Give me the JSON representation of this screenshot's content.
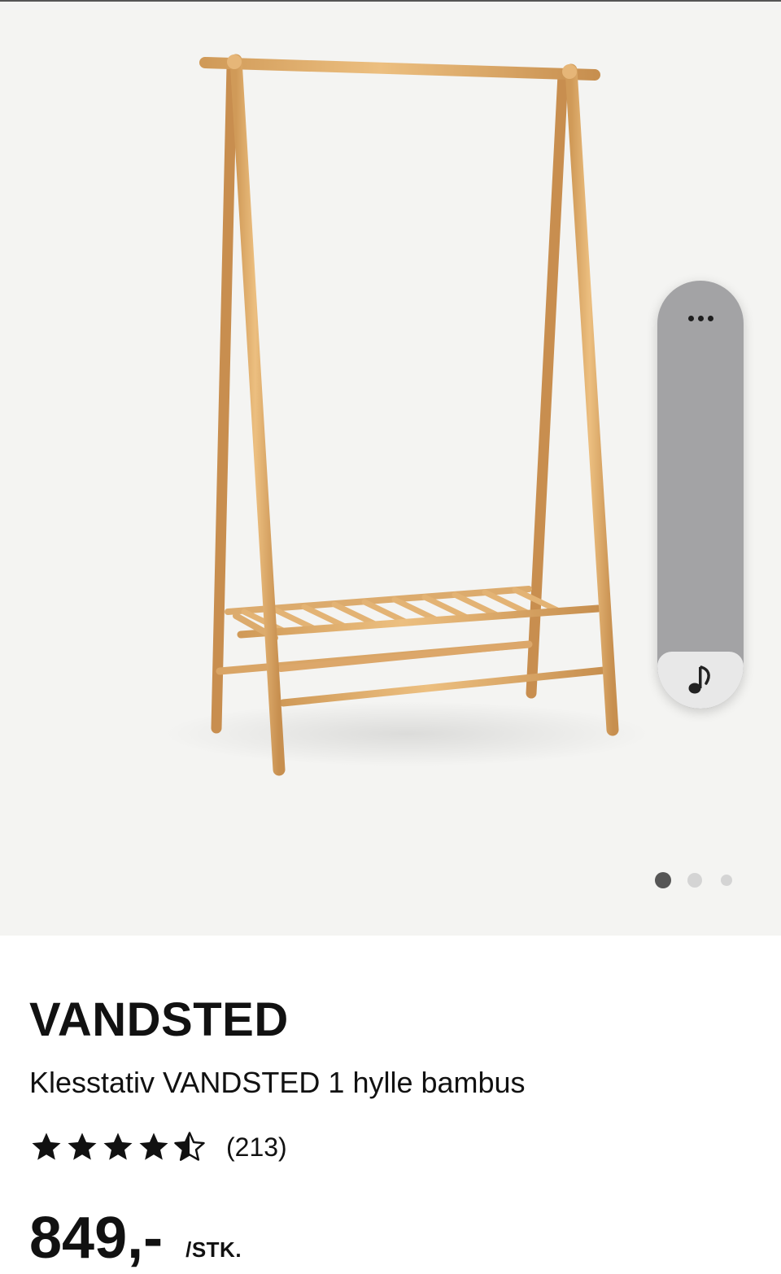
{
  "gallery": {
    "image_alt": "Klesstativ VANDSTED 1 hylle bambus",
    "slide_count": 3,
    "active_slide": 1
  },
  "panel": {
    "more_icon": "more-horizontal-icon",
    "audio_icon": "music-note-icon"
  },
  "product": {
    "brand": "VANDSTED",
    "title": "Klesstativ VANDSTED 1 hylle bambus",
    "rating": 4.5,
    "rating_max": 5,
    "review_count": "(213)",
    "price": "849,-",
    "unit": "/STK."
  },
  "colors": {
    "gallery_bg": "#f4f4f2",
    "bamboo": "#e2ae6c",
    "panel": "#a3a3a5",
    "text": "#111111"
  }
}
